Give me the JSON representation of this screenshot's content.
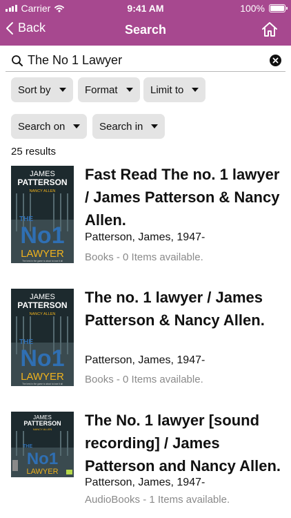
{
  "status_bar": {
    "carrier": "Carrier",
    "time": "9:41 AM",
    "battery": "100%"
  },
  "nav": {
    "back_label": "Back",
    "title": "Search",
    "home_icon": "home-icon"
  },
  "search": {
    "value": "The No 1 Lawyer",
    "placeholder": ""
  },
  "filters": [
    "Sort by",
    "Format",
    "Limit to",
    "Search on",
    "Search in"
  ],
  "results": {
    "count_label": "25 results",
    "items": [
      {
        "title": "Fast Read The no. 1 lawyer / James Patterson & Nancy Allen.",
        "author": "Patterson, James, 1947-",
        "availability": "Books - 0 Items available.",
        "cover": {
          "author_line1": "JAMES",
          "author_line2": "PATTERSON",
          "coauthor": "NANCY ALLEN",
          "title_top": "THE",
          "title_big": "No1",
          "title_bottom": "LAWYER",
          "tagline": "The best in the game is about to lose it all"
        }
      },
      {
        "title": "The no. 1 lawyer / James Patterson & Nancy Allen.",
        "author": "Patterson, James, 1947-",
        "availability": "Books - 0 Items available.",
        "cover": {
          "author_line1": "JAMES",
          "author_line2": "PATTERSON",
          "coauthor": "NANCY ALLEN",
          "title_top": "THE",
          "title_big": "No1",
          "title_bottom": "LAWYER",
          "tagline": "The best in the game is about to lose it all"
        }
      },
      {
        "title": "The No. 1 lawyer [sound recording] / James Patterson and Nancy Allen.",
        "author": "Patterson, James, 1947-",
        "availability": "AudioBooks - 1 Items available.",
        "cover": {
          "author_line1": "JAMES",
          "author_line2": "PATTERSON",
          "coauthor": "NANCY ALLEN",
          "title_top": "THE",
          "title_big": "No1",
          "title_bottom": "LAWYER",
          "tagline": ""
        }
      }
    ]
  },
  "colors": {
    "header": "#a7488f",
    "chip": "#e4e4e4",
    "cover_bg": "#1d2a2e",
    "cover_accent": "#f0b21c",
    "cover_blue": "#2f6fb3"
  }
}
